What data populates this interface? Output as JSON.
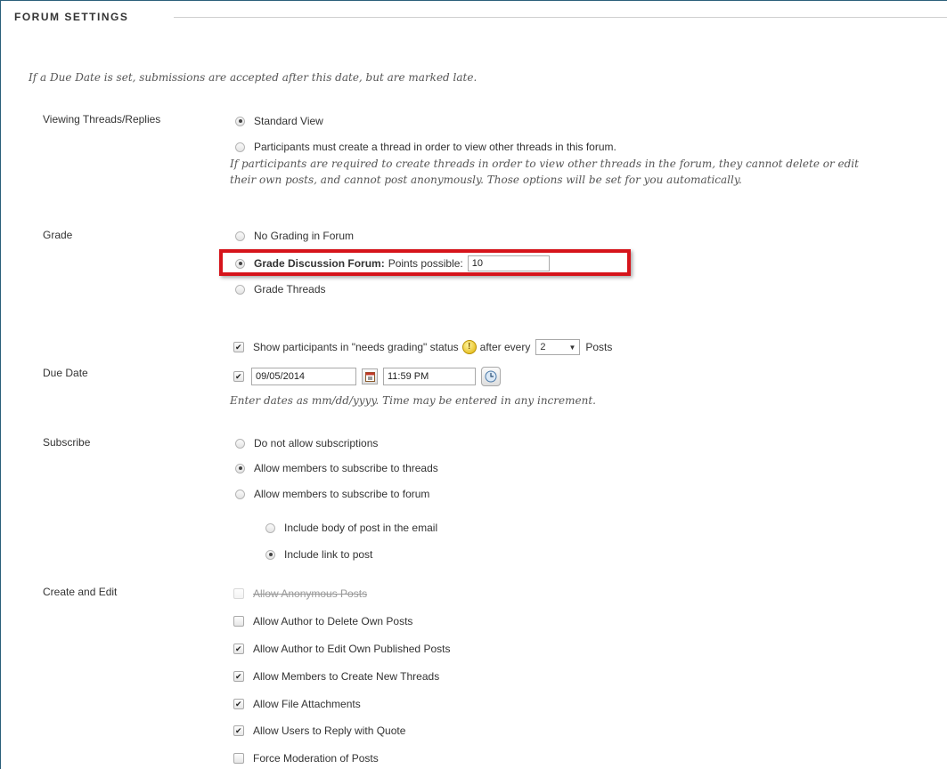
{
  "section_title": "FORUM SETTINGS",
  "intro_note": "If a Due Date is set, submissions are accepted after this date, but are marked late.",
  "viewing": {
    "label": "Viewing Threads/Replies",
    "options": [
      {
        "label": "Standard View",
        "selected": true
      },
      {
        "label": "Participants must create a thread in order to view other threads in this forum.",
        "selected": false
      }
    ],
    "note_line1": "If participants are required to create threads in order to view other threads in the forum, they cannot delete or edit",
    "note_line2": "their own posts, and cannot post anonymously. Those options will be set for you automatically."
  },
  "grade": {
    "label": "Grade",
    "no_grading": "No Grading in Forum",
    "grade_forum_bold": "Grade Discussion Forum:",
    "points_label": "Points possible:",
    "points_value": "10",
    "grade_threads": "Grade Threads",
    "selected": "grade_forum"
  },
  "needs_grading": {
    "checked": true,
    "label_before": "Show participants in \"needs grading\" status",
    "label_after_every": "after every",
    "count_value": "2",
    "label_posts": "Posts",
    "icon": "needs-grading-icon"
  },
  "due_date": {
    "label": "Due Date",
    "checked": true,
    "date_value": "09/05/2014",
    "time_value": "11:59 PM",
    "note": "Enter dates as mm/dd/yyyy. Time may be entered in any increment."
  },
  "subscribe": {
    "label": "Subscribe",
    "options": [
      {
        "label": "Do not allow subscriptions",
        "selected": false
      },
      {
        "label": "Allow members to subscribe to threads",
        "selected": true
      },
      {
        "label": "Allow members to subscribe to forum",
        "selected": false
      }
    ],
    "sub_options": [
      {
        "label": "Include body of post in the email",
        "selected": false
      },
      {
        "label": "Include link to post",
        "selected": true
      }
    ]
  },
  "create_edit": {
    "label": "Create and Edit",
    "options": [
      {
        "label": "Allow Anonymous Posts",
        "checked": false,
        "disabled": true
      },
      {
        "label": "Allow Author to Delete Own Posts",
        "checked": false,
        "disabled": false
      },
      {
        "label": "Allow Author to Edit Own Published Posts",
        "checked": true,
        "disabled": false
      },
      {
        "label": "Allow Members to Create New Threads",
        "checked": true,
        "disabled": false
      },
      {
        "label": "Allow File Attachments",
        "checked": true,
        "disabled": false
      },
      {
        "label": "Allow Users to Reply with Quote",
        "checked": true,
        "disabled": false
      },
      {
        "label": "Force Moderation of Posts",
        "checked": false,
        "disabled": false
      }
    ]
  },
  "colors": {
    "highlight": "#d6141b",
    "frame": "#2b5f7a"
  }
}
